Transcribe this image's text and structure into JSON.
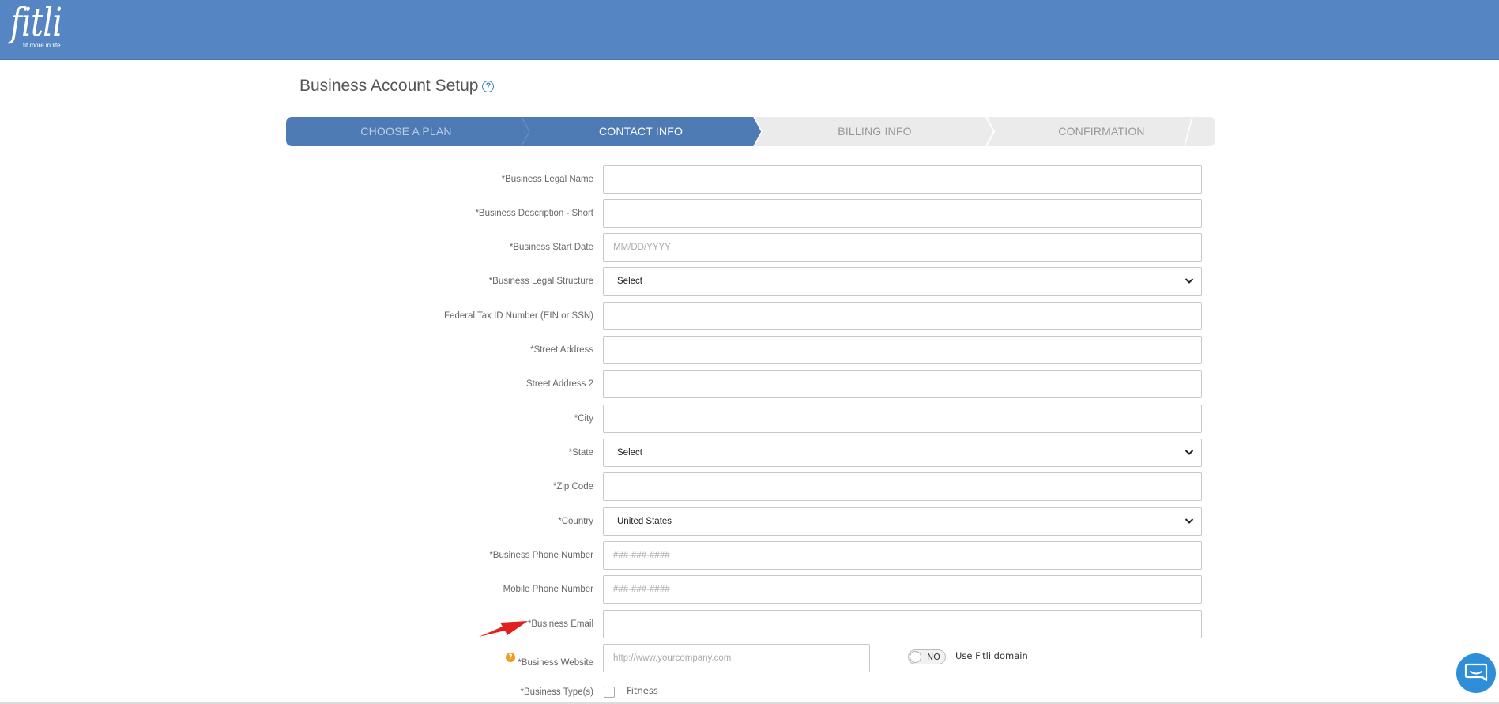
{
  "header": {
    "logo_text": "fitli",
    "logo_tagline": "fit more in life"
  },
  "page": {
    "title": "Business Account Setup"
  },
  "steps": [
    {
      "label": "CHOOSE A PLAN",
      "state": "completed"
    },
    {
      "label": "CONTACT INFO",
      "state": "active"
    },
    {
      "label": "BILLING INFO",
      "state": "pending"
    },
    {
      "label": "CONFIRMATION",
      "state": "pending"
    }
  ],
  "form": {
    "business_legal_name": {
      "label": "*Business Legal Name",
      "value": "",
      "placeholder": ""
    },
    "business_description_short": {
      "label": "*Business Description - Short",
      "value": "",
      "placeholder": ""
    },
    "business_start_date": {
      "label": "*Business Start Date",
      "value": "",
      "placeholder": "MM/DD/YYYY"
    },
    "business_legal_structure": {
      "label": "*Business Legal Structure",
      "value": "Select"
    },
    "federal_tax_id": {
      "label": "Federal Tax ID Number (EIN or SSN)",
      "value": "",
      "placeholder": ""
    },
    "street_address": {
      "label": "*Street Address",
      "value": "",
      "placeholder": ""
    },
    "street_address_2": {
      "label": "Street Address 2",
      "value": "",
      "placeholder": ""
    },
    "city": {
      "label": "*City",
      "value": "",
      "placeholder": ""
    },
    "state": {
      "label": "*State",
      "value": "Select"
    },
    "zip_code": {
      "label": "*Zip Code",
      "value": "",
      "placeholder": ""
    },
    "country": {
      "label": "*Country",
      "value": "United States"
    },
    "business_phone": {
      "label": "*Business Phone Number",
      "value": "",
      "placeholder": "###-###-####"
    },
    "mobile_phone": {
      "label": "Mobile Phone Number",
      "value": "",
      "placeholder": "###-###-####"
    },
    "business_email": {
      "label": "*Business Email",
      "value": "",
      "placeholder": ""
    },
    "business_website": {
      "label": "*Business Website",
      "value": "",
      "placeholder": "http://www.yourcompany.com"
    },
    "fitli_domain_toggle": {
      "state_label": "NO",
      "label": "Use Fitli domain"
    },
    "business_types": {
      "label": "*Business Type(s)",
      "options": [
        {
          "label": "Fitness",
          "checked": false
        }
      ]
    }
  },
  "colors": {
    "header_bg": "#5585c3",
    "step_active": "#4f7bb5",
    "step_pending": "#ebebeb",
    "annotation_arrow": "#e0201c",
    "help_badge": "#f39a1a",
    "chat_button": "#2e8fd8"
  },
  "icons": {
    "help": "question-circle-icon",
    "select_arrow": "chevron-down-icon",
    "annotation": "red-arrow-icon",
    "chat": "chat-bubble-icon"
  }
}
